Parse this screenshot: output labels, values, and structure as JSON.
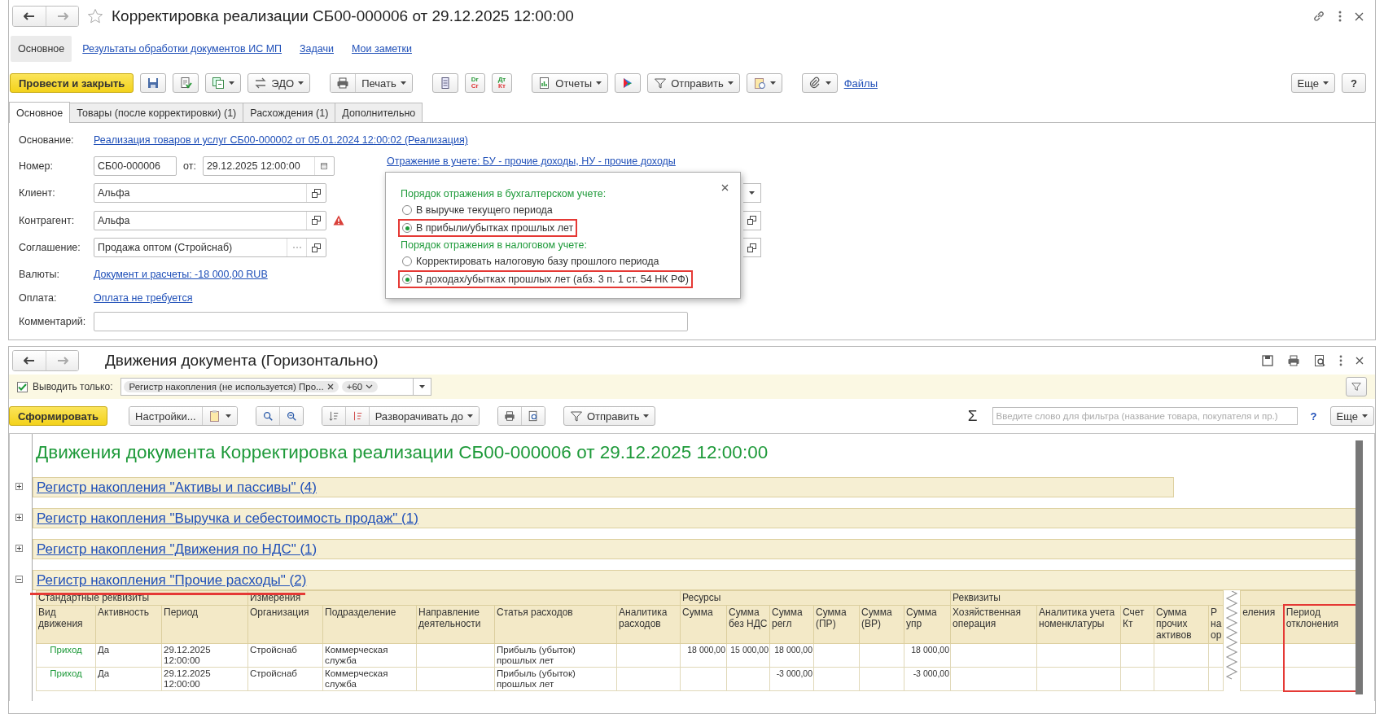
{
  "document_window": {
    "title": "Корректировка реализации СБ00-000006 от 29.12.2025 12:00:00",
    "nav": [
      {
        "label": "Основное",
        "selected": true
      },
      {
        "label": "Результаты обработки документов ИС МП",
        "selected": false
      },
      {
        "label": "Задачи",
        "selected": false
      },
      {
        "label": "Мои заметки",
        "selected": false
      }
    ],
    "toolbar": {
      "primary": "Провести и закрыть",
      "edo": "ЭДО",
      "print": "Печать",
      "dr_cr": [
        "Dr",
        "Cr"
      ],
      "dt_kt": [
        "Дт",
        "Кт"
      ],
      "reports": "Отчеты",
      "send": "Отправить",
      "files": "Файлы",
      "more": "Еще",
      "help": "?"
    },
    "tabs": [
      {
        "label": "Основное",
        "selected": true
      },
      {
        "label": "Товары (после корректировки) (1)",
        "selected": false
      },
      {
        "label": "Расхождения (1)",
        "selected": false
      },
      {
        "label": "Дополнительно",
        "selected": false
      }
    ],
    "form": {
      "basis_label": "Основание:",
      "basis_link": "Реализация товаров и услуг СБ00-000002 от 05.01.2024 12:00:02 (Реализация)",
      "number_label": "Номер:",
      "number": "СБ00-000006",
      "date_label": "от:",
      "date": "29.12.2025 12:00:00",
      "accounting_link": "Отражение в учете: БУ - прочие доходы, НУ - прочие доходы",
      "client_label": "Клиент:",
      "client": "Альфа",
      "counterparty_label": "Контрагент:",
      "counterparty": "Альфа",
      "agreement_label": "Соглашение:",
      "agreement": "Продажа оптом (Стройснаб)",
      "currency_label": "Валюты:",
      "currency_link": "Документ и расчеты: -18 000,00 RUB",
      "payment_label": "Оплата:",
      "payment_link": "Оплата не требуется",
      "comment_label": "Комментарий:"
    },
    "popup": {
      "sections": [
        {
          "heading": "Порядок отражения в бухгалтерском учете:",
          "options": [
            {
              "label": "В выручке текущего периода",
              "selected": false,
              "highlighted": false
            },
            {
              "label": "В прибыли/убытках прошлых лет",
              "selected": true,
              "highlighted": true
            }
          ]
        },
        {
          "heading": "Порядок отражения в налоговом учете:",
          "options": [
            {
              "label": "Корректировать налоговую базу прошлого периода",
              "selected": false,
              "highlighted": false
            },
            {
              "label": "В доходах/убытках прошлых лет (абз. 3 п. 1 ст. 54 НК РФ)",
              "selected": true,
              "highlighted": true
            }
          ]
        }
      ]
    }
  },
  "report_window": {
    "title": "Движения документа (Горизонтально)",
    "filter": {
      "checked": true,
      "label": "Выводить только:",
      "token": "Регистр накопления (не используется) Про...",
      "more_token": "+60"
    },
    "toolbar": {
      "generate": "Сформировать",
      "settings": "Настройки...",
      "expand": "Разворачивать до",
      "send": "Отправить",
      "sigma": "Σ",
      "search_placeholder": "Введите слово для фильтра (название товара, покупателя и пр.)",
      "help": "?",
      "more": "Еще"
    },
    "report": {
      "title": "Движения документа Корректировка реализации СБ00-000006 от 29.12.2025 12:00:00",
      "registers": [
        {
          "name": "Регистр накопления \"Активы и пассивы\" (4)",
          "expanded": false,
          "underlined": false
        },
        {
          "name": "Регистр накопления \"Выручка и себестоимость продаж\" (1)",
          "expanded": false,
          "underlined": false
        },
        {
          "name": "Регистр накопления \"Движения по НДС\" (1)",
          "expanded": false,
          "underlined": false
        },
        {
          "name": "Регистр накопления \"Прочие расходы\" (2)",
          "expanded": true,
          "underlined": true
        }
      ],
      "groups": [
        {
          "label": "Стандартные реквизиты",
          "columns": [
            {
              "label": "Вид движения",
              "highlighted": false,
              "torn_before": false
            },
            {
              "label": "Активность",
              "highlighted": false,
              "torn_before": false
            },
            {
              "label": "Период",
              "highlighted": false,
              "torn_before": false
            }
          ]
        },
        {
          "label": "Измерения",
          "columns": [
            {
              "label": "Организация",
              "highlighted": false,
              "torn_before": false
            },
            {
              "label": "Подразделение",
              "highlighted": false,
              "torn_before": false
            },
            {
              "label": "Направление деятельности",
              "highlighted": false,
              "torn_before": false
            },
            {
              "label": "Статья расходов",
              "highlighted": false,
              "torn_before": false
            },
            {
              "label": "Аналитика расходов",
              "highlighted": false,
              "torn_before": false
            }
          ]
        },
        {
          "label": "Ресурсы",
          "columns": [
            {
              "label": "Сумма",
              "highlighted": false,
              "torn_before": false
            },
            {
              "label": "Сумма без НДС",
              "highlighted": false,
              "torn_before": false
            },
            {
              "label": "Сумма регл",
              "highlighted": false,
              "torn_before": false
            },
            {
              "label": "Сумма (ПР)",
              "highlighted": false,
              "torn_before": false
            },
            {
              "label": "Сумма (ВР)",
              "highlighted": false,
              "torn_before": false
            },
            {
              "label": "Сумма упр",
              "highlighted": false,
              "torn_before": false
            }
          ]
        },
        {
          "label": "Реквизиты",
          "columns": [
            {
              "label": "Хозяйственная операция",
              "highlighted": false,
              "torn_before": false
            },
            {
              "label": "Аналитика учета номенклатуры",
              "highlighted": false,
              "torn_before": false
            },
            {
              "label": "Счет Кт",
              "highlighted": false,
              "torn_before": false
            },
            {
              "label": "Сумма прочих активов",
              "highlighted": false,
              "torn_before": false
            },
            {
              "label": "Р на ор",
              "highlighted": false,
              "torn_before": false
            },
            {
              "label": "еления",
              "highlighted": false,
              "torn_before": true
            },
            {
              "label": "Период отклонения",
              "highlighted": true,
              "torn_before": false
            }
          ]
        }
      ],
      "rows": [
        {
          "cells": [
            "Приход",
            "Да",
            "29.12.2025 12:00:00",
            "Стройснаб",
            "Коммерческая служба",
            null,
            "Прибыль (убыток) прошлых лет",
            null,
            "18 000,00",
            "15 000,00",
            "18 000,00",
            null,
            null,
            "18 000,00",
            null,
            null,
            null,
            null,
            null,
            null,
            null
          ]
        },
        {
          "cells": [
            "Приход",
            "Да",
            "29.12.2025 12:00:00",
            "Стройснаб",
            "Коммерческая служба",
            null,
            "Прибыль (убыток) прошлых лет",
            null,
            null,
            null,
            "-3 000,00",
            null,
            null,
            "-3 000,00",
            null,
            null,
            null,
            null,
            null,
            null,
            null
          ]
        }
      ]
    }
  }
}
